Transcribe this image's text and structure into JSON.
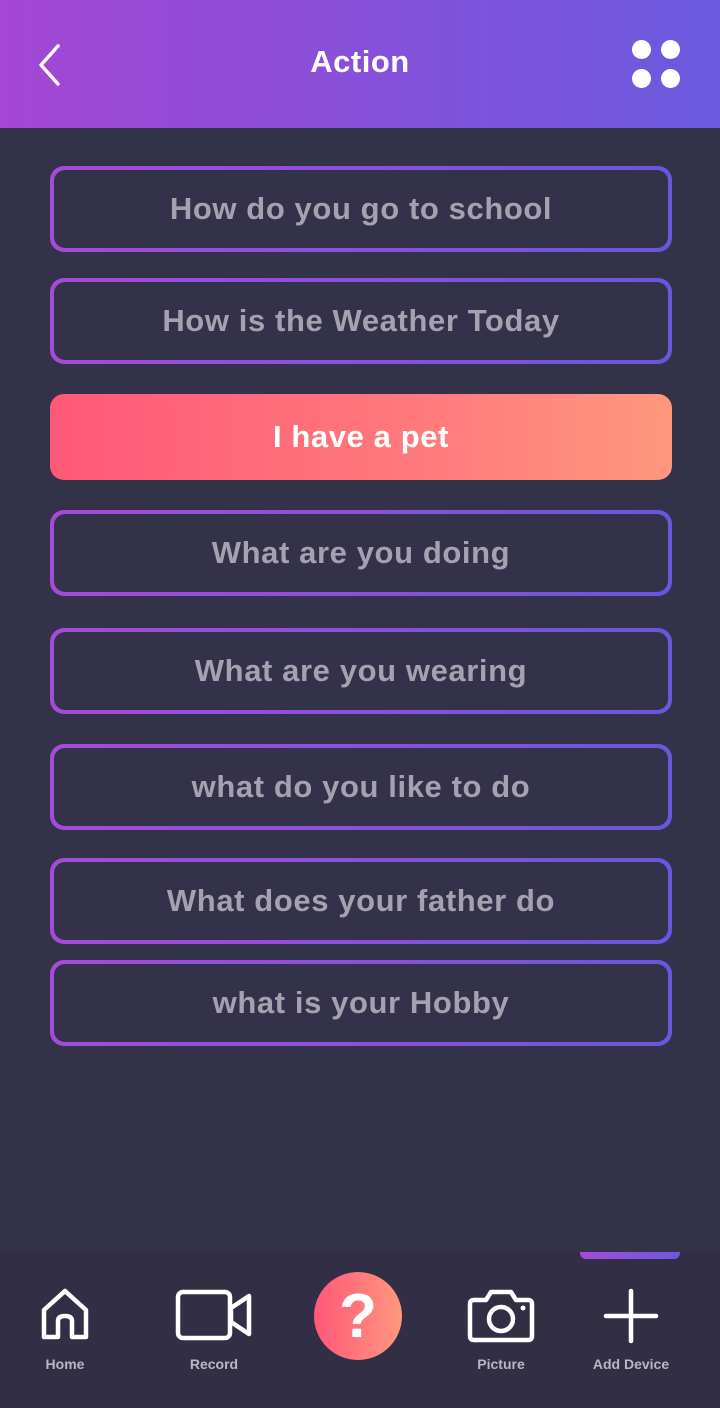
{
  "header": {
    "title": "Action",
    "back_icon": "chevron-left-icon",
    "menu_icon": "grid-dots-icon"
  },
  "phrases": [
    {
      "label": "How do you go to school",
      "active": false
    },
    {
      "label": "How is the Weather Today",
      "active": false
    },
    {
      "label": "I have a pet",
      "active": true
    },
    {
      "label": "What are you doing",
      "active": false
    },
    {
      "label": "What are you wearing",
      "active": false
    },
    {
      "label": "what do you like to do",
      "active": false
    },
    {
      "label": "What does your father do",
      "active": false
    },
    {
      "label": "what is your Hobby",
      "active": false
    }
  ],
  "nav": {
    "home": {
      "label": "Home",
      "icon": "home-icon"
    },
    "record": {
      "label": "Record",
      "icon": "video-camera-icon"
    },
    "help": {
      "label": "?",
      "icon": "question-icon"
    },
    "picture": {
      "label": "Picture",
      "icon": "camera-icon"
    },
    "add_device": {
      "label": "Add Device",
      "icon": "plus-icon",
      "selected": true
    }
  },
  "colors": {
    "background": "#34314a",
    "header_gradient_start": "#a446d6",
    "header_gradient_end": "#6a5ade",
    "active_gradient_start": "#ff5878",
    "active_gradient_end": "#ff977d",
    "inactive_text": "#a4a2b0"
  }
}
